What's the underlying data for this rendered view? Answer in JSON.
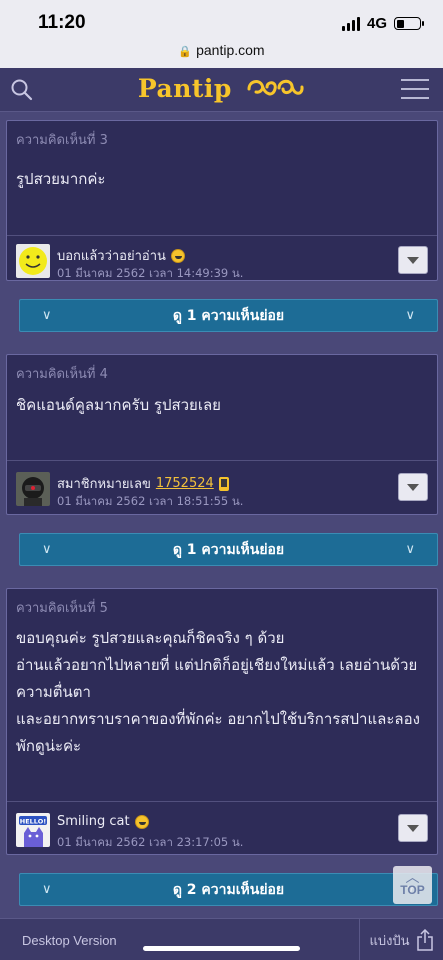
{
  "status_bar": {
    "time": "11:20",
    "network": "4G",
    "battery_level": 0.35,
    "url": "pantip.com"
  },
  "header": {
    "logo": "Pantip",
    "search_icon": "search-icon",
    "menu_icon": "hamburger-menu-icon",
    "accent_color": "#f7c52b"
  },
  "comments": [
    {
      "number": "ความคิดเห็นที่ 3",
      "text": "รูปสวยมากค่ะ",
      "username": "บอกแล้วว่าอย่าอ่าน",
      "date": "01 มีนาคม 2562 เวลา 14:49:39 น.",
      "avatar_icon": "smiley-avatar",
      "reply_label": "ดู 1 ความเห็นย่อย"
    },
    {
      "number": "ความคิดเห็นที่ 4",
      "text": "ชิคแอนด์คูลมากครับ รูปสวยเลย",
      "username": "สมาชิกหมายเลข",
      "member_id": "1752524",
      "date": "01 มีนาคม 2562 เวลา 18:51:55 น.",
      "avatar_icon": "helmet-avatar",
      "reply_label": "ดู 1 ความเห็นย่อย"
    },
    {
      "number": "ความคิดเห็นที่ 5",
      "text": "ขอบคุณค่ะ  รูปสวยและคุณก็ชิคจริง ๆ ด้วย\nอ่านแล้วอยากไปหลายที่ แต่ปกติก็อยู่เชียงใหม่แล้ว  เลยอ่านด้วยความตื่นตา\nและอยากทราบราคาของที่พักค่ะ  อยากไปใช้บริการสปาและลองพักดูน่ะค่ะ",
      "username": "Smiling cat",
      "date": "01 มีนาคม 2562 เวลา 23:17:05 น.",
      "avatar_icon": "hello-cat-avatar",
      "avatar_text": "HELLO!",
      "reply_label": "ดู 2 ความเห็นย่อย"
    }
  ],
  "scroll_top": {
    "label": "TOP"
  },
  "footer": {
    "desktop_label": "Desktop Version",
    "share_label": "แบ่งปัน"
  }
}
